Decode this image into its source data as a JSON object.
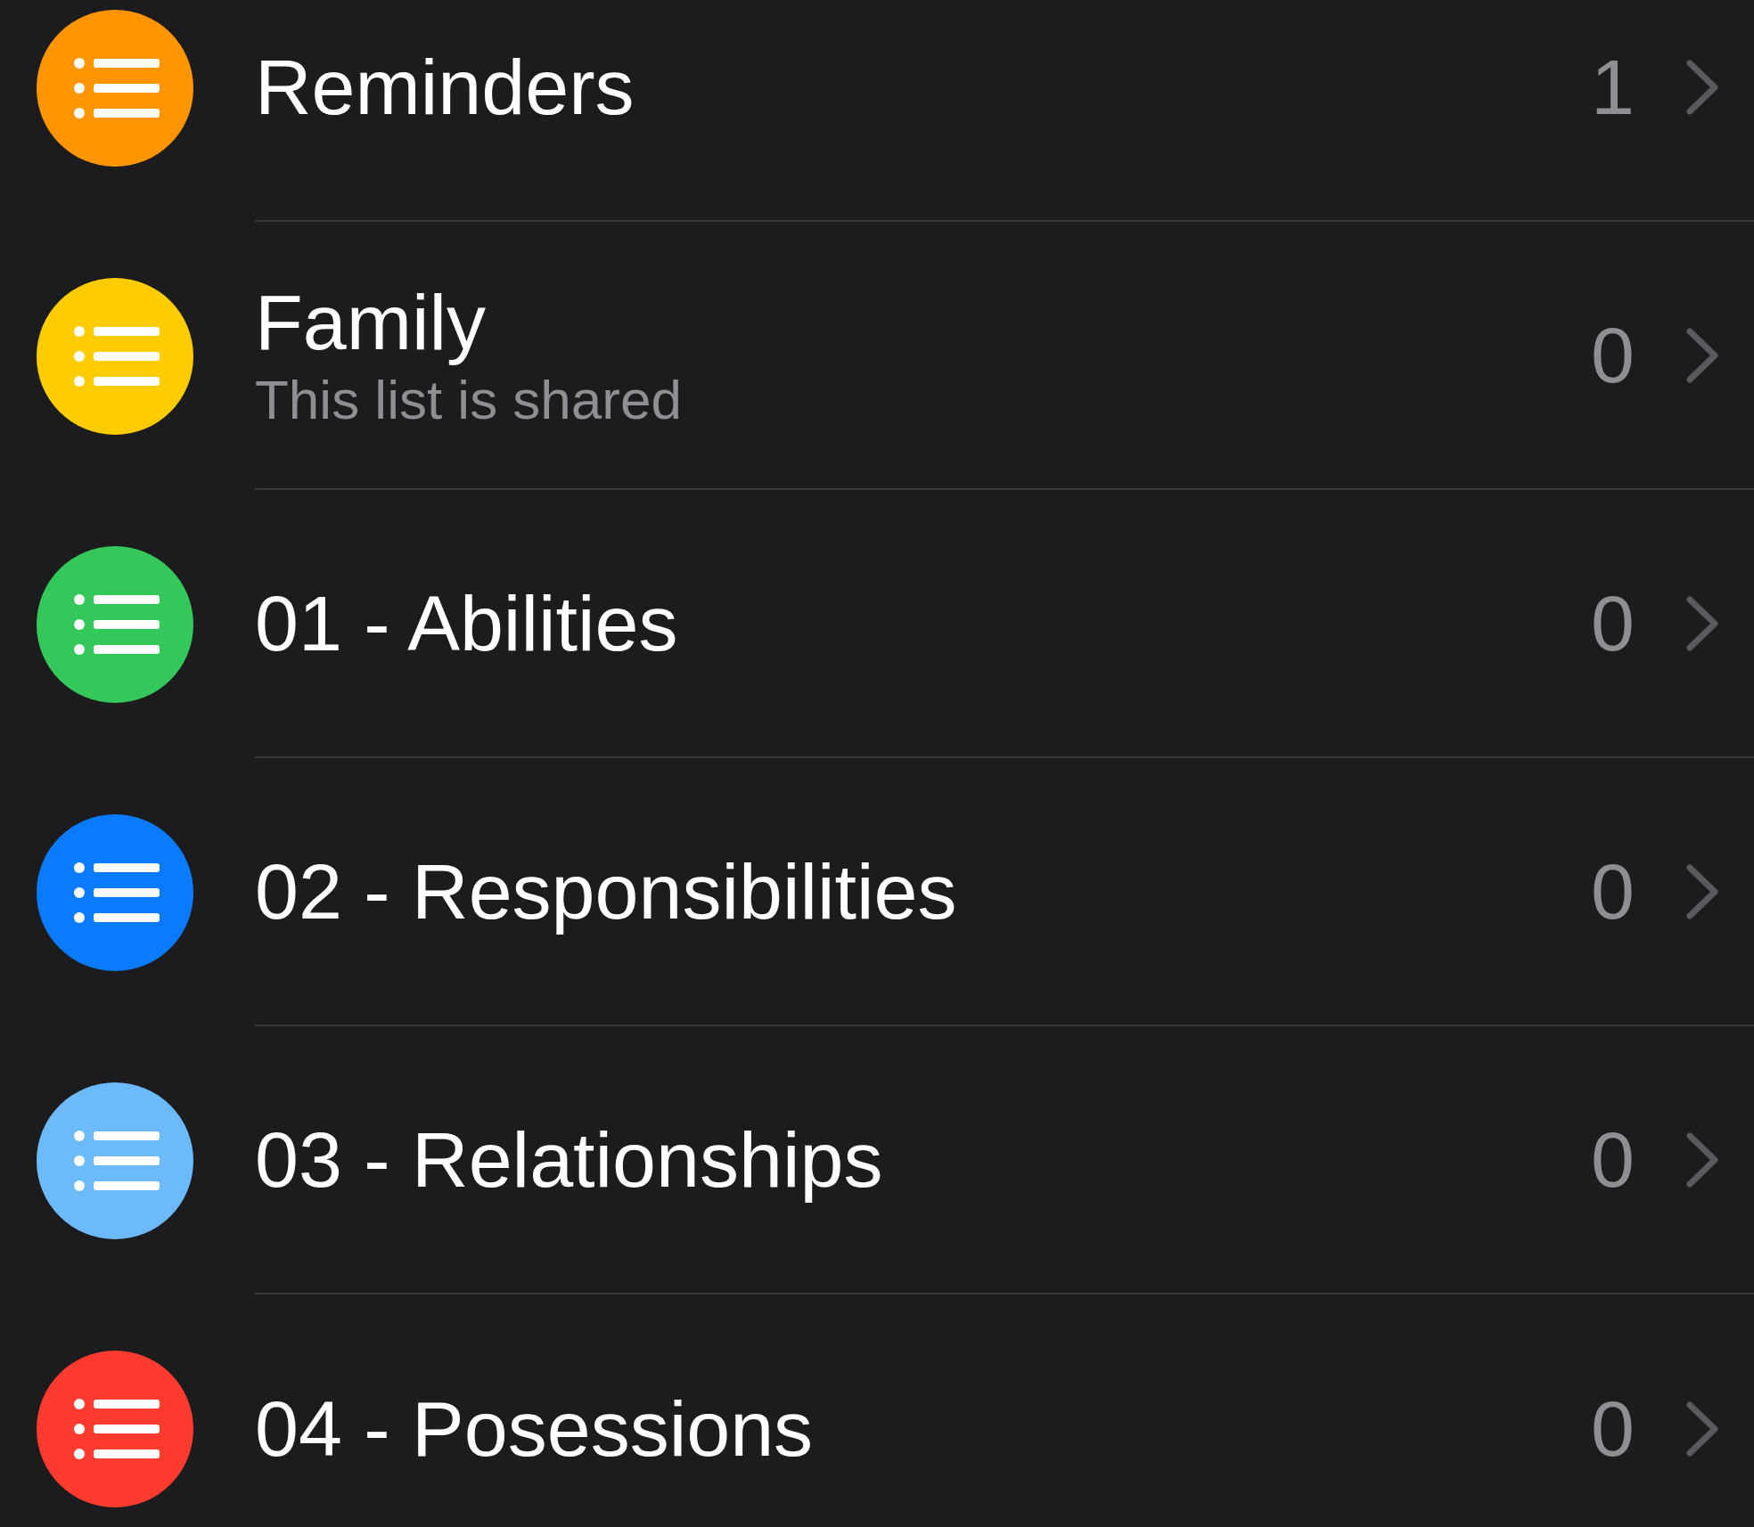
{
  "lists": [
    {
      "name": "Reminders",
      "count": "1",
      "color": "#ff9500"
    },
    {
      "name": "Family",
      "subtitle": "This list is shared",
      "count": "0",
      "color": "#ffcc00"
    },
    {
      "name": "01 - Abilities",
      "count": "0",
      "color": "#34c759"
    },
    {
      "name": "02 - Responsibilities",
      "count": "0",
      "color": "#0a7aff"
    },
    {
      "name": "03 - Relationships",
      "count": "0",
      "color": "#6cbaf9"
    },
    {
      "name": "04 - Posessions",
      "count": "0",
      "color": "#ff3b30"
    }
  ]
}
